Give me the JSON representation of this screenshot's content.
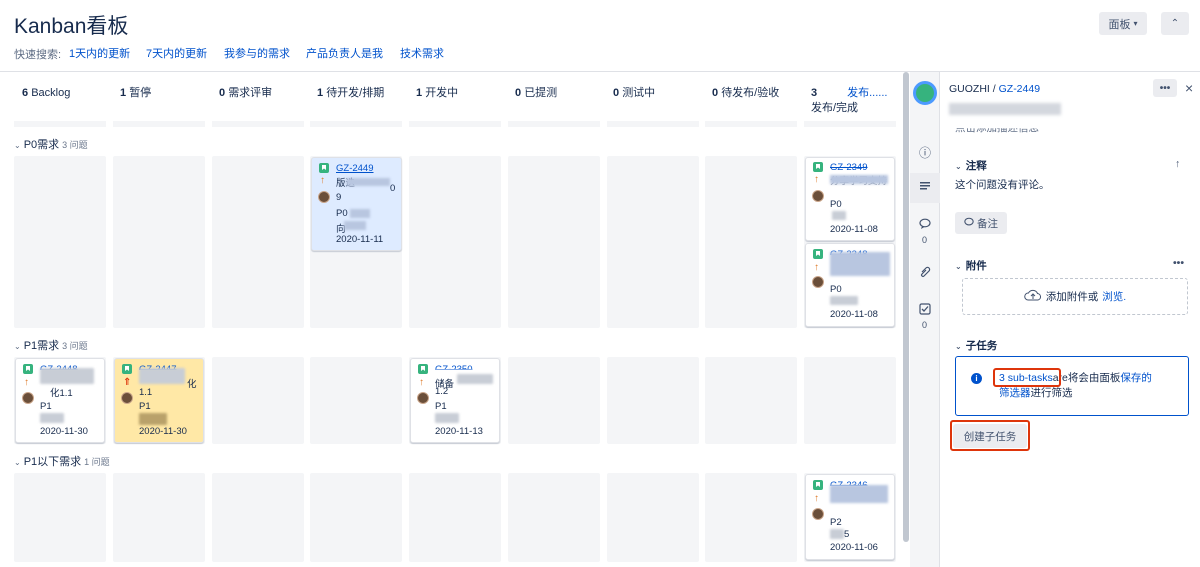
{
  "app": {
    "title": "Kanban看板"
  },
  "quick_search": {
    "label": "快速搜索:",
    "filters": [
      "1天内的更新",
      "7天内的更新",
      "我参与的需求",
      "产品负责人是我",
      "技术需求"
    ]
  },
  "top_buttons": {
    "board": "面板",
    "board_caret": "▾",
    "collapse": "⌃"
  },
  "columns": [
    {
      "count": "6",
      "name": "Backlog"
    },
    {
      "count": "1",
      "name": "暂停"
    },
    {
      "count": "0",
      "name": "需求评审"
    },
    {
      "count": "1",
      "name": "待开发/排期"
    },
    {
      "count": "1",
      "name": "开发中"
    },
    {
      "count": "0",
      "name": "已提测"
    },
    {
      "count": "0",
      "name": "测试中"
    },
    {
      "count": "0",
      "name": "待发布/验收"
    },
    {
      "count": "3",
      "name": "发布/完成",
      "link": "发布......"
    }
  ],
  "swimlanes": [
    {
      "name": "P0需求",
      "count": "3 问题"
    },
    {
      "name": "P1需求",
      "count": "3 问题"
    },
    {
      "name": "P1以下需求",
      "count": "1 问题"
    }
  ],
  "cards": {
    "gz2449": {
      "key": "GZ-2449",
      "t1": "版迭",
      "t2": "0",
      "t3": "9",
      "prio": "P0",
      "t4": "向",
      "date": "2020-11-11"
    },
    "gz2349": {
      "key": "GZ-2349",
      "t1": "分享学习支持",
      "prio": "P0",
      "date": "2020-11-08"
    },
    "gz2348": {
      "key": "GZ-2348",
      "prio": "P0",
      "date": "2020-11-08"
    },
    "gz2448": {
      "key": "GZ-2448",
      "t1": "化1.1",
      "prio": "P1",
      "date": "2020-11-30"
    },
    "gz2447": {
      "key": "GZ-2447",
      "t1": "化",
      "t2": "1.1",
      "prio": "P1",
      "date": "2020-11-30"
    },
    "gz2350": {
      "key": "GZ-2350",
      "t1": "储备",
      "t2": "1.2",
      "prio": "P1",
      "date": "2020-11-13"
    },
    "gz2346": {
      "key": "GZ-2346",
      "prio": "P2",
      "t1": "5",
      "date": "2020-11-06"
    }
  },
  "panel": {
    "project": "GUOZHI",
    "sep": " / ",
    "key": "GZ-2449",
    "more": "•••",
    "close": "×",
    "cut_text": "点击添加描述信息",
    "comments_title": "注释",
    "no_comments": "这个问题没有评论。",
    "comment_btn": "备注",
    "attach_title": "附件",
    "attach_more": "•••",
    "attach_add": "添加附件或",
    "attach_browse": "浏览.",
    "sub_title": "子任务",
    "sub_link": "3 sub-tasks",
    "sub_text1": "are将会由面板",
    "sub_saved": "保存的",
    "sub_filter": "筛选器",
    "sub_text2": "进行筛选",
    "create_sub": "创建子任务"
  },
  "rail": {
    "info": "ⓘ",
    "comment_count": "0",
    "check_count": "0"
  },
  "colors": {
    "accent": "#0052cc",
    "story": "#36b37e",
    "priority": "#de7a28",
    "highlight": "#de350b"
  }
}
